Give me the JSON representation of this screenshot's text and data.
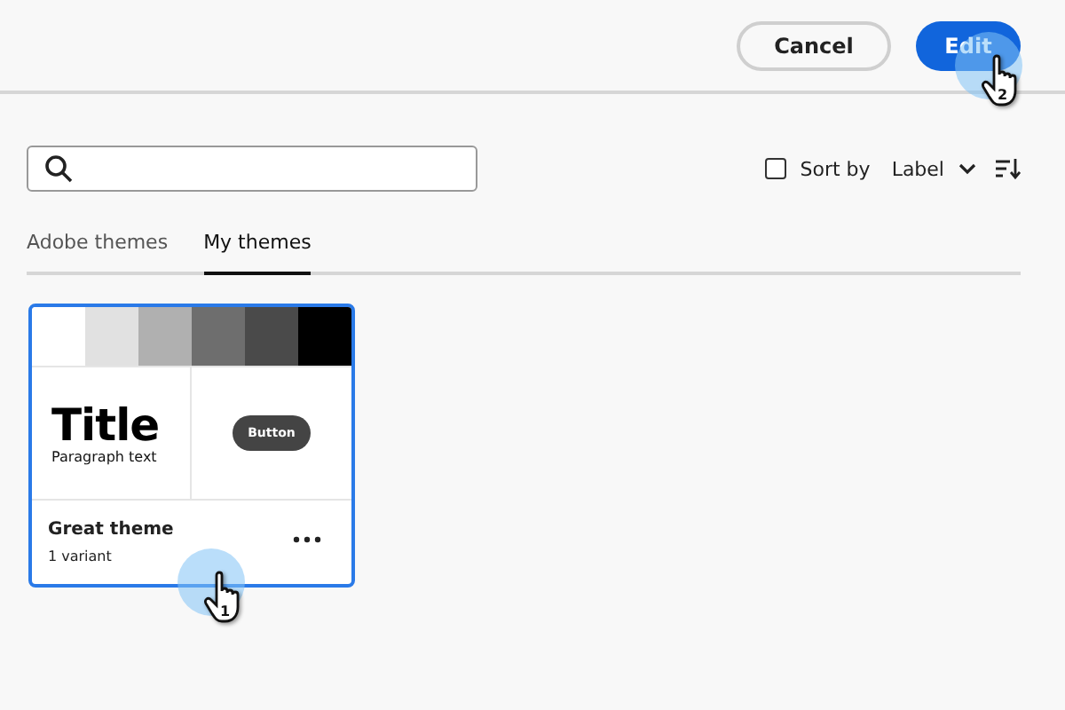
{
  "header": {
    "buttons": [
      {
        "label": "Cancel",
        "kind": "secondary"
      },
      {
        "label": "Edit",
        "kind": "primary"
      }
    ],
    "cursor": {
      "label": "2"
    }
  },
  "toolbar": {
    "sort_checkbox": {
      "label": "Sort by",
      "checked": false
    },
    "sort_field": {
      "value": "Label"
    }
  },
  "tabs": [
    {
      "label": "Adobe themes",
      "selected": false
    },
    {
      "label": "My themes",
      "selected": true
    }
  ],
  "cards": [
    {
      "title": "Great theme",
      "subtitle": "1 variant",
      "selected": true,
      "preview_title": "Title",
      "preview_text": "Paragraph text",
      "preview_button": "Button",
      "cursor": {
        "label": "1"
      },
      "swatches": [
        {
          "color": "#ffffff"
        },
        {
          "color": "#e1e1e1"
        },
        {
          "color": "#b0b0b0"
        },
        {
          "color": "#6e6e6e"
        },
        {
          "color": "#4a4a4a"
        },
        {
          "color": "#000000"
        }
      ]
    }
  ]
}
